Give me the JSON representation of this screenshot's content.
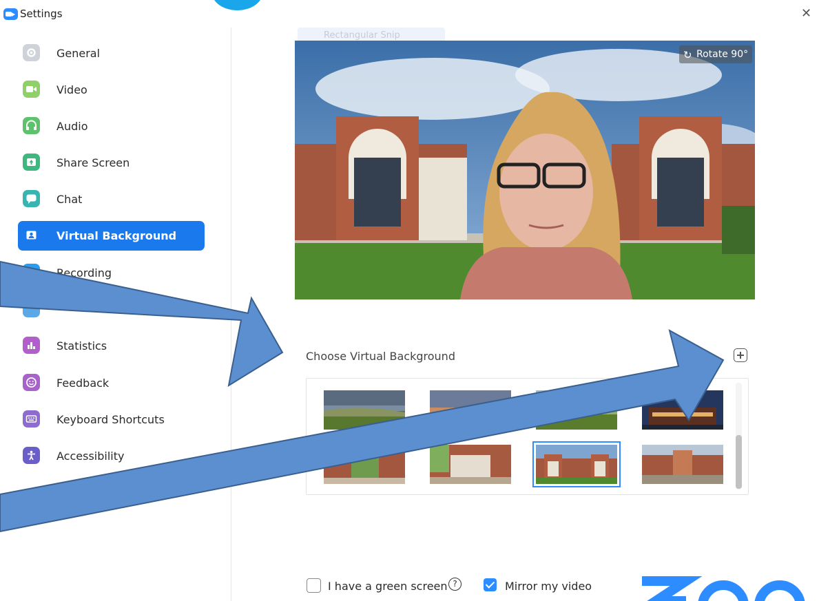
{
  "window": {
    "title": "Settings",
    "close_icon": "close-icon"
  },
  "sidebar": {
    "items": [
      {
        "label": "General",
        "icon": "gear-icon",
        "color": "#cfd3d9"
      },
      {
        "label": "Video",
        "icon": "video-camera-icon",
        "color": "#90d06a"
      },
      {
        "label": "Audio",
        "icon": "headphones-icon",
        "color": "#5cc26b"
      },
      {
        "label": "Share Screen",
        "icon": "share-screen-icon",
        "color": "#3fb880"
      },
      {
        "label": "Chat",
        "icon": "chat-bubble-icon",
        "color": "#37b6b1"
      },
      {
        "label": "Virtual Background",
        "icon": "person-card-icon",
        "color": "#1a79ec",
        "active": true
      },
      {
        "label": "Recording",
        "icon": "record-icon",
        "color": "#2a9df0"
      },
      {
        "label": "Statistics",
        "icon": "bar-chart-icon",
        "color": "#b25ecb"
      },
      {
        "label": "Feedback",
        "icon": "smiley-icon",
        "color": "#a763c9"
      },
      {
        "label": "Keyboard Shortcuts",
        "icon": "keyboard-icon",
        "color": "#8d6bcf"
      },
      {
        "label": "Accessibility",
        "icon": "accessibility-icon",
        "color": "#6a5fc9"
      }
    ]
  },
  "preview": {
    "ghost_menu_label": "Rectangular Snip",
    "rotate_label": "Rotate 90°",
    "rotate_icon": "rotate-icon"
  },
  "backgrounds": {
    "section_label": "Choose Virtual Background",
    "add_icon": "plus-icon",
    "thumbnails": [
      {
        "name": "thumb-bg-1",
        "scene": "landscape-valley",
        "selected": false
      },
      {
        "name": "thumb-bg-2",
        "scene": "sunset-sky",
        "selected": false
      },
      {
        "name": "thumb-bg-3",
        "scene": "green-field",
        "selected": false
      },
      {
        "name": "thumb-bg-4",
        "scene": "night-building",
        "selected": false
      },
      {
        "name": "thumb-bg-5",
        "scene": "campus-trees",
        "selected": false
      },
      {
        "name": "thumb-bg-6",
        "scene": "courtyard-building",
        "selected": false
      },
      {
        "name": "thumb-bg-7",
        "scene": "twin-buildings",
        "selected": true
      },
      {
        "name": "thumb-bg-8",
        "scene": "campus-plaza",
        "selected": false
      }
    ]
  },
  "options": {
    "green_screen_label": "I have a green screen",
    "green_screen_checked": false,
    "mirror_label": "Mirror my video",
    "mirror_checked": true,
    "help_icon": "question-circle-icon"
  },
  "brand": {
    "logo": "zoom-logo",
    "color": "#2d8cff"
  },
  "annotation": {
    "arrow_color": "#5b8fcf",
    "arrow_outline": "#3a5f8f"
  }
}
